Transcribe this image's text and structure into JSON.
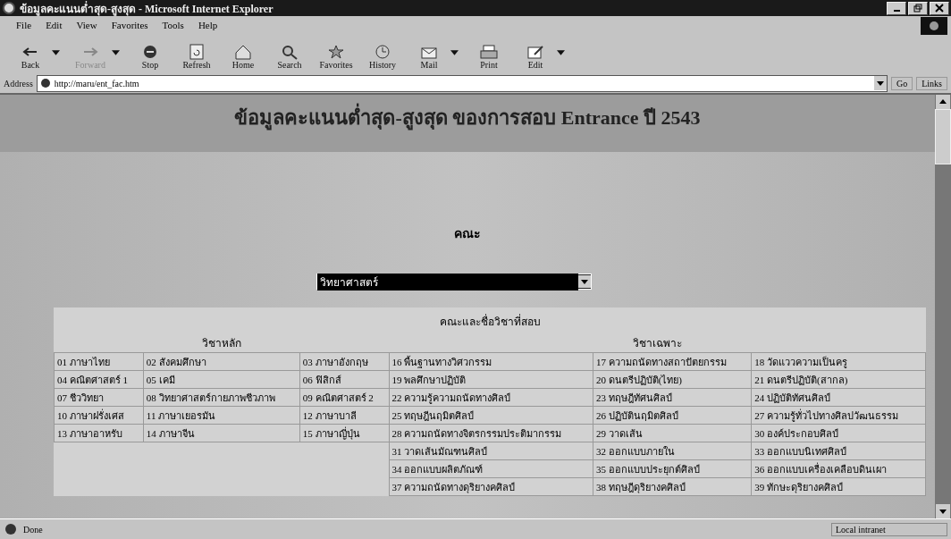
{
  "window": {
    "title": "ข้อมูลคะแนนต่ำสุด-สูงสุด - Microsoft Internet Explorer"
  },
  "menu": [
    "File",
    "Edit",
    "View",
    "Favorites",
    "Tools",
    "Help"
  ],
  "toolbar": [
    {
      "label": "Back",
      "disabled": false,
      "dropdown": true
    },
    {
      "label": "Forward",
      "disabled": true,
      "dropdown": true
    },
    {
      "label": "Stop",
      "disabled": false,
      "dropdown": false
    },
    {
      "label": "Refresh",
      "disabled": false,
      "dropdown": false
    },
    {
      "label": "Home",
      "disabled": false,
      "dropdown": false
    },
    {
      "label": "Search",
      "disabled": false,
      "dropdown": false
    },
    {
      "label": "Favorites",
      "disabled": false,
      "dropdown": false
    },
    {
      "label": "History",
      "disabled": false,
      "dropdown": false
    },
    {
      "label": "Mail",
      "disabled": false,
      "dropdown": true
    },
    {
      "label": "Print",
      "disabled": false,
      "dropdown": false
    },
    {
      "label": "Edit",
      "disabled": false,
      "dropdown": true
    }
  ],
  "address": {
    "label": "Address",
    "value": "http://maru/ent_fac.htm",
    "go": "Go",
    "links": "Links"
  },
  "page": {
    "heading": "ข้อมูลคะแนนต่ำสุด-สูงสุด ของการสอบ Entrance ปี 2543",
    "faculty_label": "คณะ",
    "faculty_select": "วิทยาศาสตร์",
    "table": {
      "caption": "คณะและชื่อวิชาที่สอบ",
      "main": {
        "title": "วิชาหลัก",
        "rows": [
          [
            "01 ภาษาไทย",
            "02 สังคมศึกษา",
            "03 ภาษาอังกฤษ"
          ],
          [
            "04 คณิตศาสตร์ 1",
            "05 เคมี",
            "06 ฟิสิกส์"
          ],
          [
            "07 ชีววิทยา",
            "08 วิทยาศาสตร์กายภาพชีวภาพ",
            "09 คณิตศาสตร์ 2"
          ],
          [
            "10 ภาษาฝรั่งเศส",
            "11 ภาษาเยอรมัน",
            "12 ภาษาบาลี"
          ],
          [
            "13 ภาษาอาหรับ",
            "14 ภาษาจีน",
            "15 ภาษาญี่ปุ่น"
          ]
        ]
      },
      "special": {
        "title": "วิชาเฉพาะ",
        "rows": [
          [
            "16 พื้นฐานทางวิศวกรรม",
            "17 ความถนัดทางสถาปัตยกรรม",
            "18 วัดแววความเป็นครู"
          ],
          [
            "19 พลศึกษาปฏิบัติ",
            "20 ดนตรีปฏิบัติ(ไทย)",
            "21 ดนตรีปฏิบัติ(สากล)"
          ],
          [
            "22 ความรู้ความถนัดทางศิลป์",
            "23 ทฤษฎีทัศนศิลป์",
            "24 ปฏิบัติทัศนศิลป์"
          ],
          [
            "25 ทฤษฎีนฤมิตศิลป์",
            "26 ปฏิบัตินฤมิตศิลป์",
            "27 ความรู้ทั่วไปทางศิลปวัฒนธรรม"
          ],
          [
            "28 ความถนัดทางจิตรกรรมประติมากรรม",
            "29 วาดเส้น",
            "30 องค์ประกอบศิลป์"
          ],
          [
            "31 วาดเส้นมัณฑนศิลป์",
            "32 ออกแบบภายใน",
            "33 ออกแบบนิเทศศิลป์"
          ],
          [
            "34 ออกแบบผลิตภัณฑ์",
            "35 ออกแบบประยุกต์ศิลป์",
            "36 ออกแบบเครื่องเคลือบดินเผา"
          ],
          [
            "37 ความถนัดทางดุริยางคศิลป์",
            "38 ทฤษฎีดุริยางคศิลป์",
            "39 ทักษะดุริยางคศิลป์"
          ]
        ]
      }
    }
  },
  "status_bar": {
    "text": "Done",
    "zone": "Local intranet"
  }
}
